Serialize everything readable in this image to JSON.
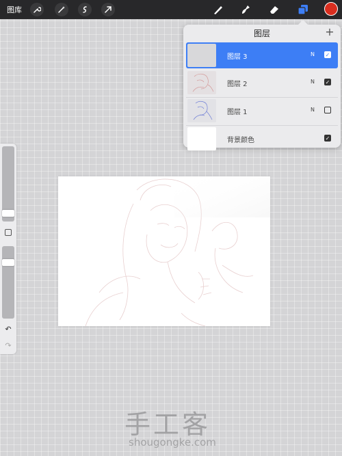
{
  "topbar": {
    "gallery_label": "图库",
    "tools_left": [
      "wrench-icon",
      "magic-wand-icon",
      "selection-icon",
      "transform-arrow-icon"
    ],
    "tools_right": [
      "brush-icon",
      "smudge-icon",
      "eraser-icon",
      "layers-icon"
    ],
    "active_color": "#d92e1f"
  },
  "layers_panel": {
    "title": "图层",
    "add_label": "+",
    "layers": [
      {
        "name": "图层 3",
        "mode": "N",
        "visible": true,
        "active": true
      },
      {
        "name": "图层 2",
        "mode": "N",
        "visible": true,
        "active": false
      },
      {
        "name": "图层 1",
        "mode": "N",
        "visible": false,
        "active": false
      },
      {
        "name": "背景颜色",
        "mode": "",
        "visible": true,
        "active": false
      }
    ]
  },
  "sidebar": {
    "brush_size_level": 0.93,
    "opacity_level": 0.2
  },
  "watermark": {
    "chinese": "手工客",
    "latin": "shougongke.com"
  },
  "colors": {
    "accent": "#3d7ef5",
    "toolbar": "#28282a",
    "panel": "#ebebed"
  }
}
